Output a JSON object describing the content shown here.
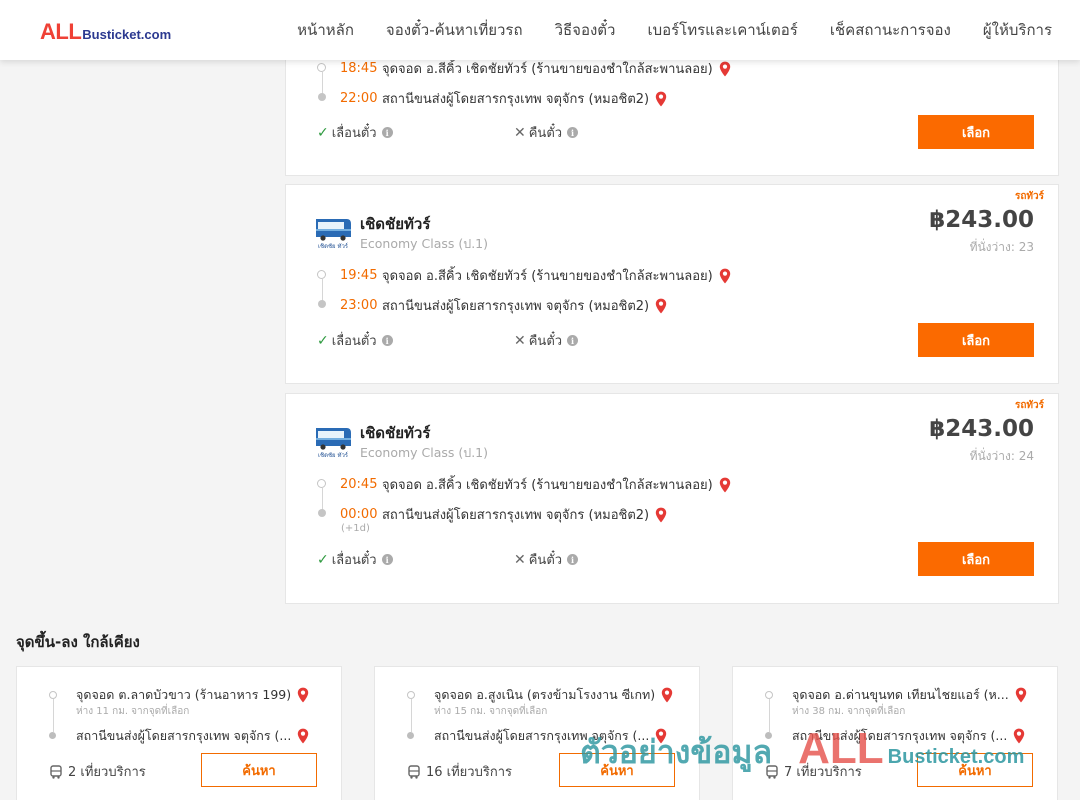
{
  "header": {
    "logo_all": "ALL",
    "logo_rest": "Busticket.com",
    "nav": [
      "หน้าหลัก",
      "จองตั๋ว-ค้นหาเที่ยวรถ",
      "วิธีจองตั๋ว",
      "เบอร์โทรและเคาน์เตอร์",
      "เช็คสถานะการจอง",
      "ผู้ให้บริการ"
    ]
  },
  "trips": [
    {
      "dep_time": "18:45",
      "dep_place": "จุดจอด อ.สีคิ้ว เชิดชัยทัวร์ (ร้านขายของชำใกล้สะพานลอย)",
      "arr_time": "22:00",
      "arr_place": "สถานีขนส่งผู้โดยสารกรุงเทพ จตุจักร (หมอชิต2)",
      "feat_change": "เลื่อนตั๋ว",
      "feat_refund": "คืนตั๋ว",
      "select_label": "เลือก"
    },
    {
      "tag": "รถทัวร์",
      "operator": "เชิดชัยทัวร์",
      "class": "Economy Class (ป.1)",
      "price": "฿243.00",
      "seats": "ที่นั่งว่าง: 23",
      "dep_time": "19:45",
      "dep_place": "จุดจอด อ.สีคิ้ว เชิดชัยทัวร์ (ร้านขายของชำใกล้สะพานลอย)",
      "arr_time": "23:00",
      "arr_place": "สถานีขนส่งผู้โดยสารกรุงเทพ จตุจักร (หมอชิต2)",
      "feat_change": "เลื่อนตั๋ว",
      "feat_refund": "คืนตั๋ว",
      "select_label": "เลือก"
    },
    {
      "tag": "รถทัวร์",
      "operator": "เชิดชัยทัวร์",
      "class": "Economy Class (ป.1)",
      "price": "฿243.00",
      "seats": "ที่นั่งว่าง: 24",
      "dep_time": "20:45",
      "dep_place": "จุดจอด อ.สีคิ้ว เชิดชัยทัวร์ (ร้านขายของชำใกล้สะพานลอย)",
      "arr_time": "00:00",
      "arr_day": "(+1d)",
      "arr_place": "สถานีขนส่งผู้โดยสารกรุงเทพ จตุจักร (หมอชิต2)",
      "feat_change": "เลื่อนตั๋ว",
      "feat_refund": "คืนตั๋ว",
      "select_label": "เลือก"
    }
  ],
  "operator_logo_text": "เชิดชัย ทัวร์",
  "nearby": {
    "title": "จุดขึ้น-ลง ใกล้เคียง",
    "items": [
      {
        "from": "จุดจอด ต.ลาดบัวขาว (ร้านอาหาร 199)",
        "distance": "ห่าง 11 กม. จากจุดที่เลือก",
        "to": "สถานีขนส่งผู้โดยสารกรุงเทพ จตุจักร (...",
        "trips": "2 เที่ยวบริการ",
        "button": "ค้นหา"
      },
      {
        "from": "จุดจอด อ.สูงเนิน (ตรงข้ามโรงงาน ซีเกท)",
        "distance": "ห่าง 15 กม. จากจุดที่เลือก",
        "to": "สถานีขนส่งผู้โดยสารกรุงเทพ จตุจักร (...",
        "trips": "16 เที่ยวบริการ",
        "button": "ค้นหา"
      },
      {
        "from": "จุดจอด อ.ด่านขุนทด เทียนไชยแอร์ (ห...",
        "distance": "ห่าง 38 กม. จากจุดที่เลือก",
        "to": "สถานีขนส่งผู้โดยสารกรุงเทพ จตุจักร (...",
        "trips": "7 เที่ยวบริการ",
        "button": "ค้นหา"
      }
    ]
  },
  "watermark": {
    "thai": "ตัวอย่างข้อมูล",
    "all": "ALL",
    "rest": "Busticket.com"
  },
  "colors": {
    "accent": "#fb6a00",
    "time": "#f26b00",
    "check": "#2e9a3f",
    "pin": "#e53935",
    "logo_red": "#ef4136",
    "logo_blue": "#2b3990"
  }
}
